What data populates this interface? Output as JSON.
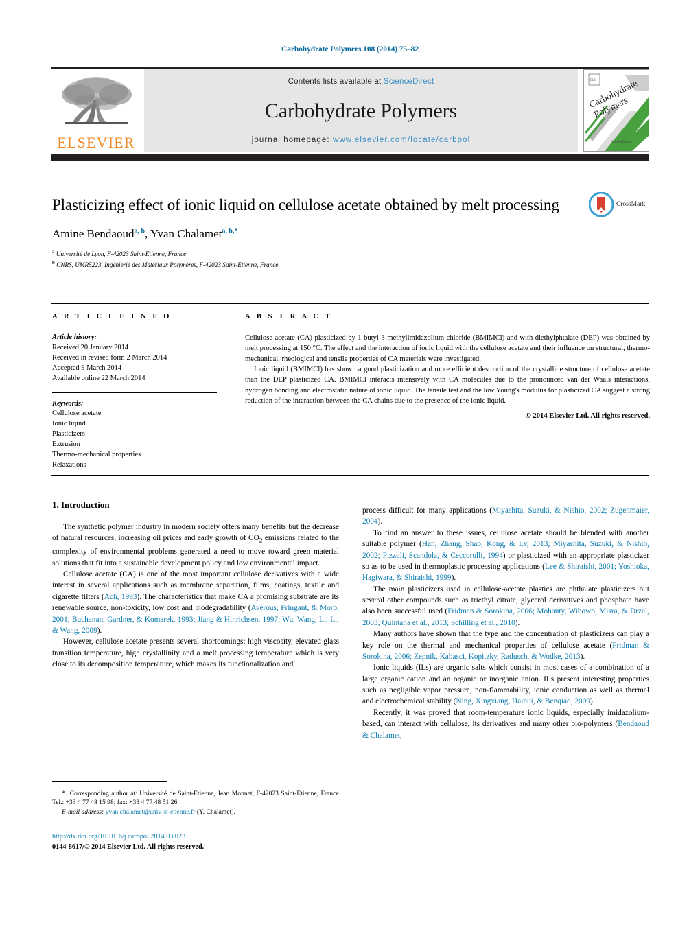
{
  "running_head": "Carbohydrate Polymers 108 (2014) 75–82",
  "masthead": {
    "contents_prefix": "Contents lists available at ",
    "sciencedirect": "ScienceDirect",
    "journal_title": "Carbohydrate Polymers",
    "homepage_prefix": "journal homepage: ",
    "homepage_url": "www.elsevier.com/locate/carbpol",
    "publisher": "ELSEVIER",
    "cover_title_line1": "Carbohydrate",
    "cover_title_line2": "Polymers",
    "colors": {
      "band_bg": "#e6e6e6",
      "link": "#3e8fc4",
      "elsevier_orange": "#f4861f",
      "bar_dark": "#231f20",
      "cover_green": "#3f9c35"
    }
  },
  "title": "Plasticizing effect of ionic liquid on cellulose acetate obtained by melt processing",
  "authors": [
    {
      "name": "Amine Bendaoud",
      "marks": "a, b"
    },
    {
      "name": "Yvan Chalamet",
      "marks": "a, b,*"
    }
  ],
  "authors_separator": ", ",
  "affiliations": [
    {
      "mark": "a",
      "text": "Université de Lyon, F-42023 Saint-Etienne, France"
    },
    {
      "mark": "b",
      "text": "CNRS, UMR5223, Ingénierie des Matériaux Polymères, F-42023 Saint-Etienne, France"
    }
  ],
  "crossmark": {
    "label": "CrossMark"
  },
  "article_info": {
    "heading": "A R T I C L E   I N F O",
    "history_label": "Article history:",
    "history": [
      "Received 20 January 2014",
      "Received in revised form 2 March 2014",
      "Accepted 9 March 2014",
      "Available online 22 March 2014"
    ],
    "keywords_label": "Keywords:",
    "keywords": [
      "Cellulose acetate",
      "Ionic liquid",
      "Plasticizers",
      "Extrusion",
      "Thermo-mechanical properties",
      "Relaxations"
    ]
  },
  "abstract": {
    "heading": "A B S T R A C T",
    "paragraphs": [
      "Cellulose acetate (CA) plasticized by 1-butyl-3-methylimidazolium chloride (BMIMCl) and with diethylphtalate (DEP) was obtained by melt processing at 150 °C. The effect and the interaction of ionic liquid with the cellulose acetate and their influence on structural, thermo-mechanical, rheological and tensile properties of CA materials were investigated.",
      "Ionic liquid (BMIMCl) has shown a good plasticization and more efficient destruction of the crystalline structure of cellulose acetate than the DEP plasticized CA. BMIMCl interacts intensively with CA molecules due to the pronounced van der Waals interactions, hydrogen bonding and electrostatic nature of ionic liquid. The tensile test and the low Young's modulus for plasticized CA suggest a strong reduction of the interaction between the CA chains due to the presence of the ionic liquid."
    ],
    "copyright": "© 2014 Elsevier Ltd. All rights reserved."
  },
  "body": {
    "section_heading": "1.  Introduction",
    "left_paragraphs": [
      {
        "parts": [
          {
            "t": "The synthetic polymer industry in modern society offers many benefits but the decrease of natural resources, increasing oil prices and early growth of CO",
            "k": "n"
          },
          {
            "t": "2",
            "k": "sub"
          },
          {
            "t": " emissions related to the complexity of environmental problems generated a need to move toward green material solutions that fit into a sustainable development policy and low environmental impact.",
            "k": "n"
          }
        ]
      },
      {
        "parts": [
          {
            "t": "Cellulose acetate (CA) is one of the most important cellulose derivatives with a wide interest in several applications such as membrane separation, films, coatings, textile and cigarette filters (",
            "k": "n"
          },
          {
            "t": "Ach, 1993",
            "k": "c"
          },
          {
            "t": "). The characteristics that make CA a promising substrate are its renewable source, non-toxicity, low cost and biodegradability (",
            "k": "n"
          },
          {
            "t": "Avérous, Fringant, & Moro, 2001; Buchanan, Gardner, & Komarek, 1993; Jiang & Hinrichsen, 1997; Wu, Wang, Li, Li, & Wang, 2009",
            "k": "c"
          },
          {
            "t": ").",
            "k": "n"
          }
        ]
      },
      {
        "parts": [
          {
            "t": "However, cellulose acetate presents several shortcomings: high viscosity, elevated glass transition temperature, high crystallinity and a melt processing temperature which is very close to its decomposition temperature, which makes its functionalization and",
            "k": "n"
          }
        ]
      }
    ],
    "right_paragraphs": [
      {
        "noindent": true,
        "parts": [
          {
            "t": "process difficult for many applications (",
            "k": "n"
          },
          {
            "t": "Miyashita, Suzuki, & Nishio, 2002; Zugenmaier, 2004",
            "k": "c"
          },
          {
            "t": ").",
            "k": "n"
          }
        ]
      },
      {
        "parts": [
          {
            "t": "To find an answer to these issues, cellulose acetate should be blended with another suitable polymer (",
            "k": "n"
          },
          {
            "t": "Han, Zhang, Shao, Kong, & Lv, 2013; Miyashita, Suzuki, & Nishio, 2002; Pizzoli, Scandola, & Ceccorulli, 1994",
            "k": "c"
          },
          {
            "t": ") or plasticized with an appropriate plasticizer so as to be used in thermoplastic processing applications (",
            "k": "n"
          },
          {
            "t": "Lee & Shiraishi, 2001; Yoshioka, Hagiwara, & Shiraishi, 1999",
            "k": "c"
          },
          {
            "t": ").",
            "k": "n"
          }
        ]
      },
      {
        "parts": [
          {
            "t": "The main plasticizers used in cellulose-acetate plastics are phthalate plasticizers but several other compounds such as triethyl citrate, glycerol derivatives and phosphate have also been successful used (",
            "k": "n"
          },
          {
            "t": "Fridman & Sorokina, 2006; Mohanty, Wibowo, Misra, & Drzal, 2003; Quintana et al., 2013; Schilling et al., 2010",
            "k": "c"
          },
          {
            "t": ").",
            "k": "n"
          }
        ]
      },
      {
        "parts": [
          {
            "t": "Many authors have shown that the type and the concentration of plasticizers can play a key role on the thermal and mechanical properties of cellulose acetate (",
            "k": "n"
          },
          {
            "t": "Fridman & Sorokina, 2006; Zepnik, Kabasci, Kopitzky, Radusch, & Wodke, 2013",
            "k": "c"
          },
          {
            "t": ").",
            "k": "n"
          }
        ]
      },
      {
        "parts": [
          {
            "t": "Ionic liquids (ILs) are organic salts which consist in most cases of a combination of a large organic cation and an organic or inorganic anion. ILs present interesting properties such as negligible vapor pressure, non-flammability, ionic conduction as well as thermal and electrochemical stability (",
            "k": "n"
          },
          {
            "t": "Ning, Xingxiang, Haihui, & Benqiao, 2009",
            "k": "c"
          },
          {
            "t": ").",
            "k": "n"
          }
        ]
      },
      {
        "parts": [
          {
            "t": "Recently, it was proved that room-temperature ionic liquids, especially imidazolium-based, can interact with cellulose, its derivatives and many other bio-polymers (",
            "k": "n"
          },
          {
            "t": "Bendaoud & Chalamet,",
            "k": "c"
          }
        ]
      }
    ]
  },
  "footnote": {
    "star": "*",
    "line1": "Corresponding author at: Université de Saint-Etienne, Jean Monnet, F-42023 Saint-Etienne, France. Tel.: +33 4 77 48 15 98; fax: +33 4 77 48 51 26.",
    "email_label": "E-mail address:",
    "email": "yvan.chalamet@univ-st-etienne.fr",
    "email_suffix": " (Y. Chalamet)."
  },
  "footer": {
    "doi": "http://dx.doi.org/10.1016/j.carbpol.2014.03.023",
    "issn": "0144-8617/© 2014 Elsevier Ltd. All rights reserved."
  }
}
